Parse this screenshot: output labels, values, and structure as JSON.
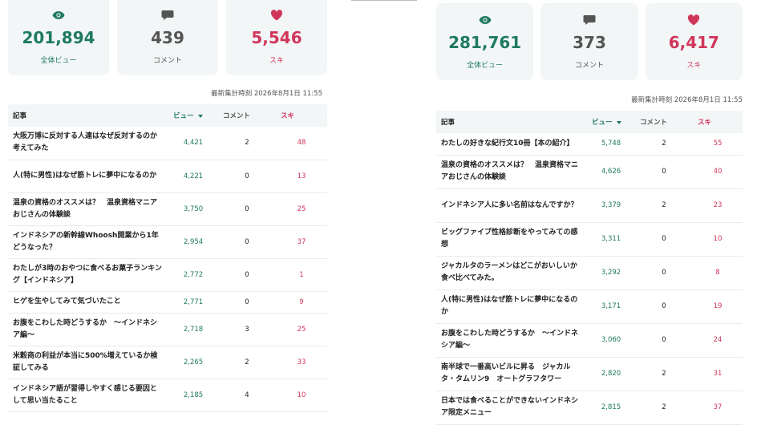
{
  "left": {
    "stats": [
      {
        "icon": "eye-icon",
        "value": "201,894",
        "label": "全体ビュー"
      },
      {
        "icon": "comment-icon",
        "value": "439",
        "label": "コメント"
      },
      {
        "icon": "heart-icon",
        "value": "5,546",
        "label": "スキ"
      }
    ],
    "timestamp": "最新集計時刻 2026年8月1日 11:55",
    "headers": {
      "article": "記事",
      "views": "ビュー",
      "comments": "コメント",
      "likes": "スキ"
    },
    "rows": [
      {
        "title": "大阪万博に反対する人達はなぜ反対するのか考えてみた",
        "views": "4,421",
        "comments": "2",
        "likes": "48"
      },
      {
        "title": "人(特に男性)はなぜ筋トレに夢中になるのか",
        "views": "4,221",
        "comments": "0",
        "likes": "13"
      },
      {
        "title": "温泉の資格のオススメは？　温泉資格マニアおじさんの体験談",
        "views": "3,750",
        "comments": "0",
        "likes": "25"
      },
      {
        "title": "インドネシアの新幹線Whoosh開業から1年　どうなった？",
        "views": "2,954",
        "comments": "0",
        "likes": "37"
      },
      {
        "title": "わたしが3時のおやつに食べるお菓子ランキング【インドネシア】",
        "views": "2,772",
        "comments": "0",
        "likes": "1"
      },
      {
        "title": "ヒゲを生やしてみて気づいたこと",
        "views": "2,771",
        "comments": "0",
        "likes": "9"
      },
      {
        "title": "お腹をこわした時どうするか　〜インドネシア編〜",
        "views": "2,718",
        "comments": "3",
        "likes": "25"
      },
      {
        "title": "米穀商の利益が本当に500%増えているか検証してみる",
        "views": "2,265",
        "comments": "2",
        "likes": "33"
      },
      {
        "title": "インドネシア語が習得しやすく感じる要因として思い当たること",
        "views": "2,185",
        "comments": "4",
        "likes": "10"
      }
    ]
  },
  "right": {
    "stats": [
      {
        "icon": "eye-icon",
        "value": "281,761",
        "label": "全体ビュー"
      },
      {
        "icon": "comment-icon",
        "value": "373",
        "label": "コメント"
      },
      {
        "icon": "heart-icon",
        "value": "6,417",
        "label": "スキ"
      }
    ],
    "timestamp": "最新集計時刻 2026年8月1日 11:55",
    "headers": {
      "article": "記事",
      "views": "ビュー",
      "comments": "コメント",
      "likes": "スキ"
    },
    "rows": [
      {
        "title": "わたしの好きな紀行文10冊【本の紹介】",
        "views": "5,748",
        "comments": "2",
        "likes": "55"
      },
      {
        "title": "温泉の資格のオススメは？　温泉資格マニアおじさんの体験談",
        "views": "4,626",
        "comments": "0",
        "likes": "40"
      },
      {
        "title": "インドネシア人に多い名前はなんですか？",
        "views": "3,379",
        "comments": "2",
        "likes": "23"
      },
      {
        "title": "ビッグファイブ性格診断をやってみての感想",
        "views": "3,311",
        "comments": "0",
        "likes": "10"
      },
      {
        "title": "ジャカルタのラーメンはどこがおいしいか食べ比べてみた。",
        "views": "3,292",
        "comments": "0",
        "likes": "8"
      },
      {
        "title": "人(特に男性)はなぜ筋トレに夢中になるのか",
        "views": "3,171",
        "comments": "0",
        "likes": "19"
      },
      {
        "title": "お腹をこわした時どうするか　〜インドネシア編〜",
        "views": "3,060",
        "comments": "0",
        "likes": "24"
      },
      {
        "title": "南半球で一番高いビルに昇る　ジャカルタ・タムリン9　オートグラフタワー",
        "views": "2,820",
        "comments": "2",
        "likes": "31"
      },
      {
        "title": "日本では食べることができないインドネシア限定メニュー",
        "views": "2,815",
        "comments": "2",
        "likes": "37"
      }
    ]
  }
}
